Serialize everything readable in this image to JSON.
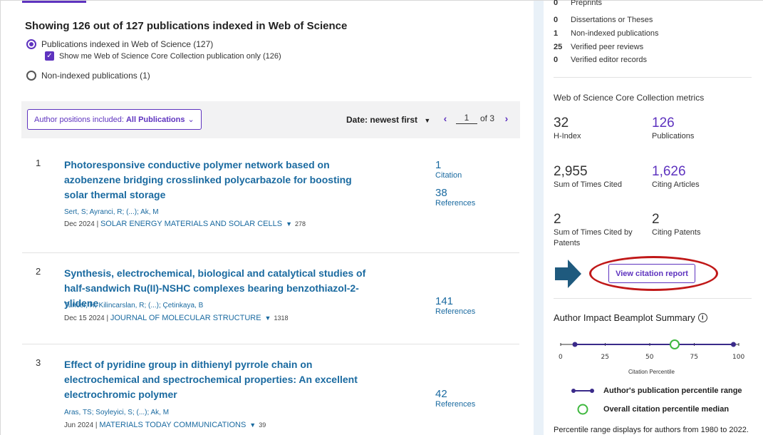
{
  "results": {
    "showing_text": "Showing 126 out of 127 publications indexed in Web of Science",
    "filter_indexed_label": "Publications indexed in Web of Science (127)",
    "filter_core_only_label": "Show me Web of Science Core Collection publication only (126)",
    "filter_nonindexed_label": "Non-indexed publications (1)"
  },
  "toolbar": {
    "author_positions_prefix": "Author positions included:",
    "author_positions_value": "All Publications",
    "sort_label": "Date: newest first",
    "page_current": "1",
    "page_total_text": "of 3"
  },
  "records": [
    {
      "num": "1",
      "title": "Photoresponsive conductive polymer network based on azobenzene bridging crosslinked polycarbazole for boosting solar thermal storage",
      "authors": "Sert, S; Ayranci, R; (...); Ak, M",
      "date": "Dec 2024 | ",
      "journal": "SOLAR ENERGY MATERIALS AND SOLAR CELLS",
      "journal_badge": "278",
      "citations_num": "1",
      "citations_label": "Citation",
      "references_num": "38",
      "references_label": "References"
    },
    {
      "num": "2",
      "title": "Synthesis, electrochemical, biological and catalytical studies of half-sandwich Ru(II)-NSHC complexes bearing benzothiazol-2-ylidene",
      "authors": "Tuncer, H; Kilincarslan, R; (...); Çetinkaya, B",
      "date": "Dec 15 2024 | ",
      "journal": "JOURNAL OF MOLECULAR STRUCTURE",
      "journal_badge": "1318",
      "references_num": "141",
      "references_label": "References"
    },
    {
      "num": "3",
      "title": "Effect of pyridine group in dithienyl pyrrole chain on electrochemical and spectrochemical properties: An excellent electrochromic polymer",
      "authors": "Aras, TS; Soyleyici, S; (...); Ak, M",
      "date": "Jun 2024 | ",
      "journal": "MATERIALS TODAY COMMUNICATIONS",
      "journal_badge": "39",
      "references_num": "42",
      "references_label": "References"
    }
  ],
  "doc_types": [
    {
      "n": "0",
      "label": "Preprints"
    },
    {
      "n": "0",
      "label": "Dissertations or Theses"
    },
    {
      "n": "1",
      "label": "Non-indexed publications"
    },
    {
      "n": "25",
      "label": "Verified peer reviews"
    },
    {
      "n": "0",
      "label": "Verified editor records"
    }
  ],
  "metrics": {
    "title": "Web of Science Core Collection metrics",
    "h_index": "32",
    "h_index_label": "H-Index",
    "publications": "126",
    "publications_label": "Publications",
    "times_cited": "2,955",
    "times_cited_label": "Sum of Times Cited",
    "citing_articles": "1,626",
    "citing_articles_label": "Citing Articles",
    "times_cited_patents": "2",
    "times_cited_patents_label": "Sum of Times Cited by Patents",
    "citing_patents": "2",
    "citing_patents_label": "Citing Patents",
    "view_report_label": "View citation report"
  },
  "beamplot": {
    "title": "Author Impact Beamplot Summary",
    "ticks": [
      "0",
      "25",
      "50",
      "75",
      "100"
    ],
    "axis_label": "Citation Percentile",
    "range_min": 8,
    "range_max": 97,
    "median": 64,
    "legend_range": "Author's publication percentile range",
    "legend_median": "Overall citation percentile median",
    "footer": "Percentile range displays for authors from 1980 to 2022."
  },
  "colors": {
    "accent_purple": "#5e33bf",
    "link_blue": "#1a6aa0",
    "annotation_red": "#c01818",
    "annotation_arrow": "#1f5a7e",
    "median_green": "#3fb83f"
  }
}
